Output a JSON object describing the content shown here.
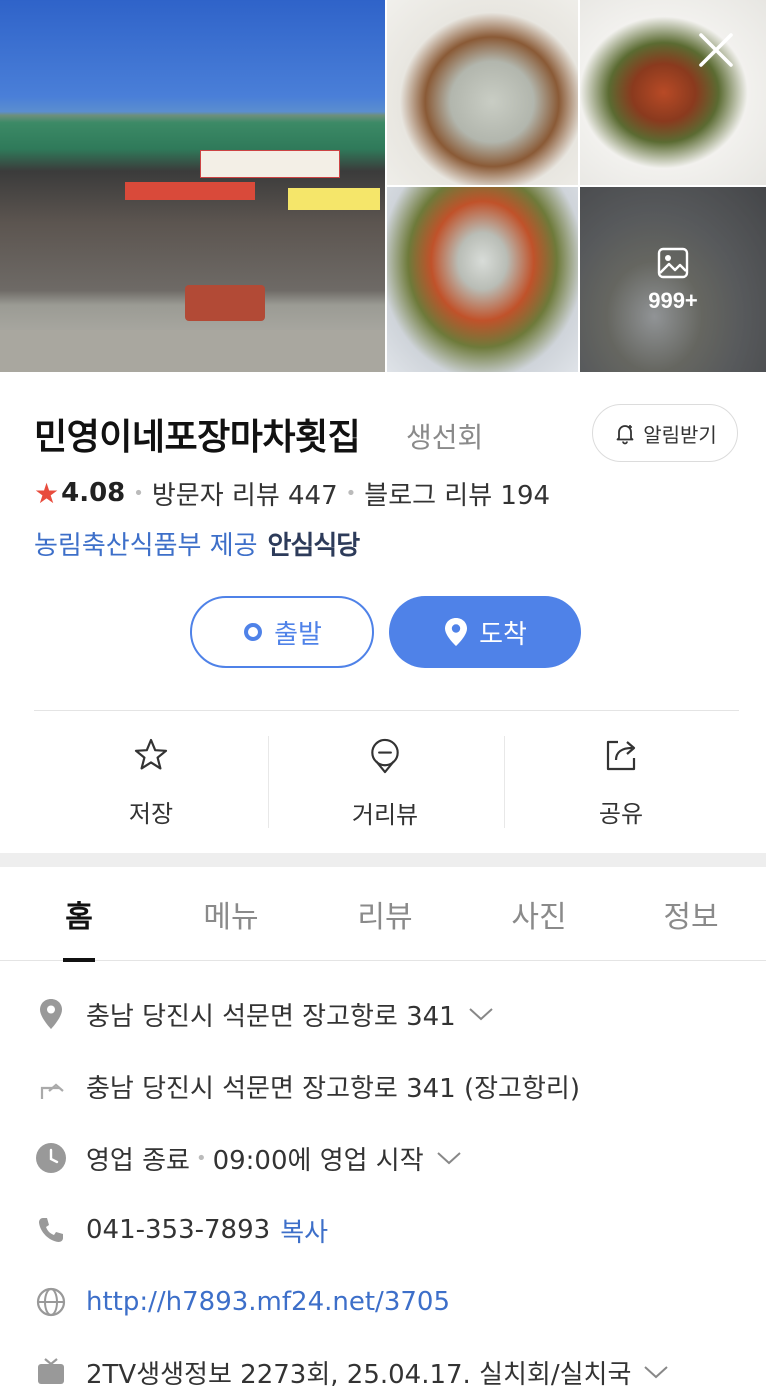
{
  "gallery": {
    "more_count": "999+",
    "photos": [
      "storefront",
      "dish-1",
      "dish-2",
      "dish-3",
      "dish-4"
    ]
  },
  "header": {
    "name": "민영이네포장마차횟집",
    "category": "생선회",
    "alarm_label": "알림받기"
  },
  "rating": {
    "score": "4.08",
    "visitor_reviews": "방문자 리뷰 447",
    "blog_reviews": "블로그 리뷰 194"
  },
  "provider": {
    "text": "농림축산식품부 제공",
    "badge": "안심식당"
  },
  "route": {
    "start_label": "출발",
    "arrive_label": "도착"
  },
  "actions": {
    "save_label": "저장",
    "street_label": "거리뷰",
    "share_label": "공유"
  },
  "tabs": {
    "home": "홈",
    "menu": "메뉴",
    "review": "리뷰",
    "photo": "사진",
    "info": "정보"
  },
  "info": {
    "address": "충남 당진시 석문면 장고항로 341",
    "old_address": "충남 당진시 석문면 장고항로 341 (장고항리)",
    "status": "영업 종료",
    "hours": "09:00에 영업 시작",
    "phone": "041-353-7893",
    "copy_label": "복사",
    "website": "http://h7893.mf24.net/3705",
    "tv": "2TV생생정보 2273회, 25.04.17. 실치회/실치국"
  },
  "colors": {
    "accent": "#4f82e8",
    "link": "#3d6fc9",
    "star": "#e84c3d"
  }
}
